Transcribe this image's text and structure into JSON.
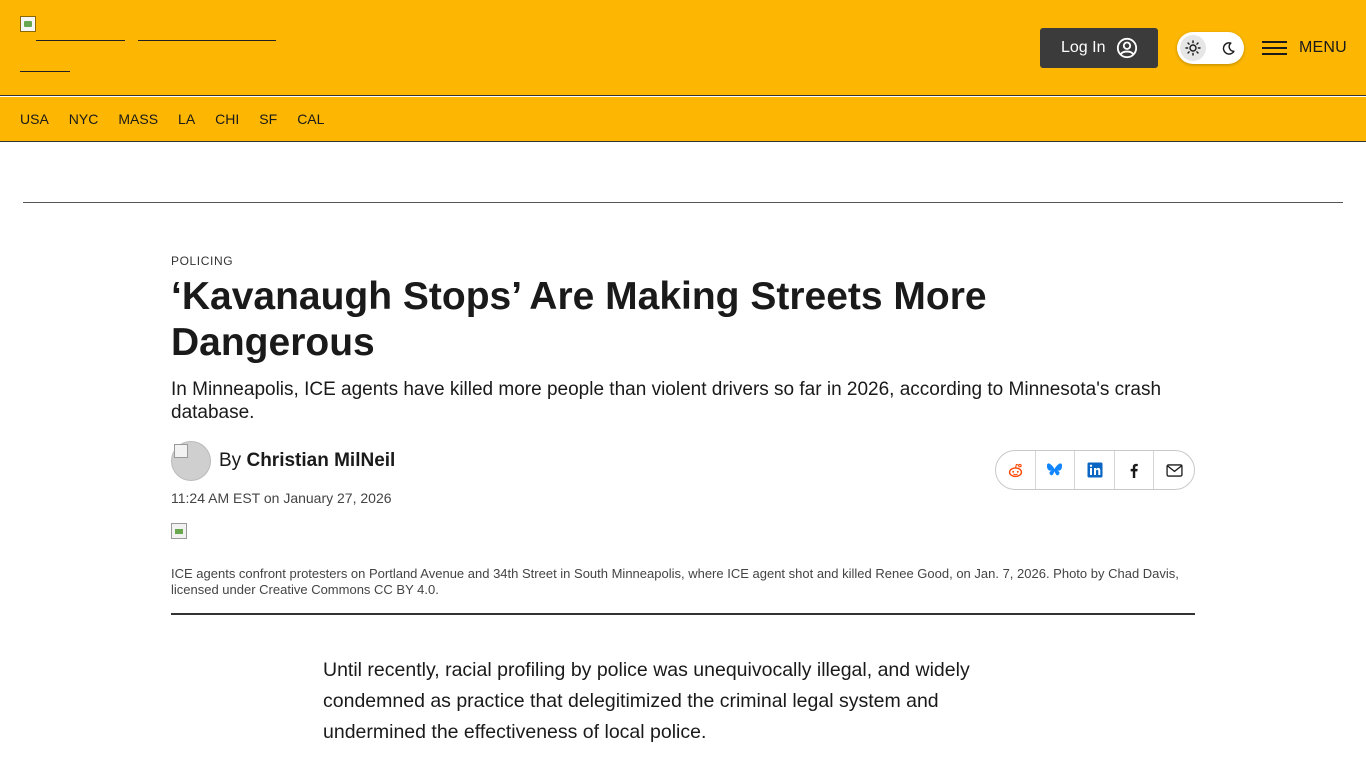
{
  "header": {
    "login_label": "Log In",
    "menu_label": "MENU",
    "brand_color": "#fdb702"
  },
  "city_nav": [
    "USA",
    "NYC",
    "MASS",
    "LA",
    "CHI",
    "SF",
    "CAL"
  ],
  "article": {
    "kicker": "POLICING",
    "headline": "‘Kavanaugh Stops’ Are Making Streets More Dangerous",
    "dek": "In Minneapolis, ICE agents have killed more people than violent drivers so far in 2026, according to Minnesota's crash database.",
    "byline_prefix": "By",
    "author": "Christian MilNeil",
    "timestamp": "11:24 AM EST on January 27, 2026",
    "caption": "ICE agents confront protesters on Portland Avenue and 34th Street in South Minneapolis, where ICE agent shot and killed Renee Good, on Jan. 7, 2026. Photo by Chad Davis, licensed under Creative Commons CC BY 4.0.",
    "body": "Until recently, racial profiling by police was unequivocally illegal, and widely condemned as practice that delegitimized the criminal legal system and undermined the effectiveness of local police."
  },
  "share_icons": [
    "reddit-icon",
    "bluesky-icon",
    "linkedin-icon",
    "facebook-icon",
    "email-icon"
  ],
  "icon_colors": {
    "reddit": "#ff4500",
    "bluesky": "#1185fe",
    "linkedin": "#0a66c2",
    "facebook": "#1a1a1a",
    "email": "#1a1a1a"
  }
}
